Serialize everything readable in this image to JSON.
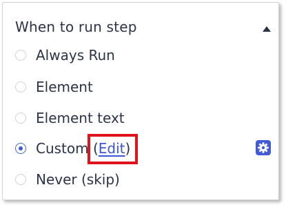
{
  "section": {
    "title": "When to run step"
  },
  "options": [
    {
      "label": "Always Run",
      "selected": false
    },
    {
      "label": "Element",
      "selected": false
    },
    {
      "label": "Element text",
      "selected": false
    },
    {
      "label": "Custom",
      "selected": true,
      "edit_open": "(",
      "edit_link": "Edit",
      "edit_close": ")"
    },
    {
      "label": "Never (skip)",
      "selected": false
    }
  ],
  "icons": {
    "collapse": "triangle-up-icon",
    "settings": "gear-icon"
  },
  "colors": {
    "text": "#2b3348",
    "accent": "#3f5bd5",
    "highlight": "#e0121c",
    "radio_border": "#d0d3da"
  }
}
